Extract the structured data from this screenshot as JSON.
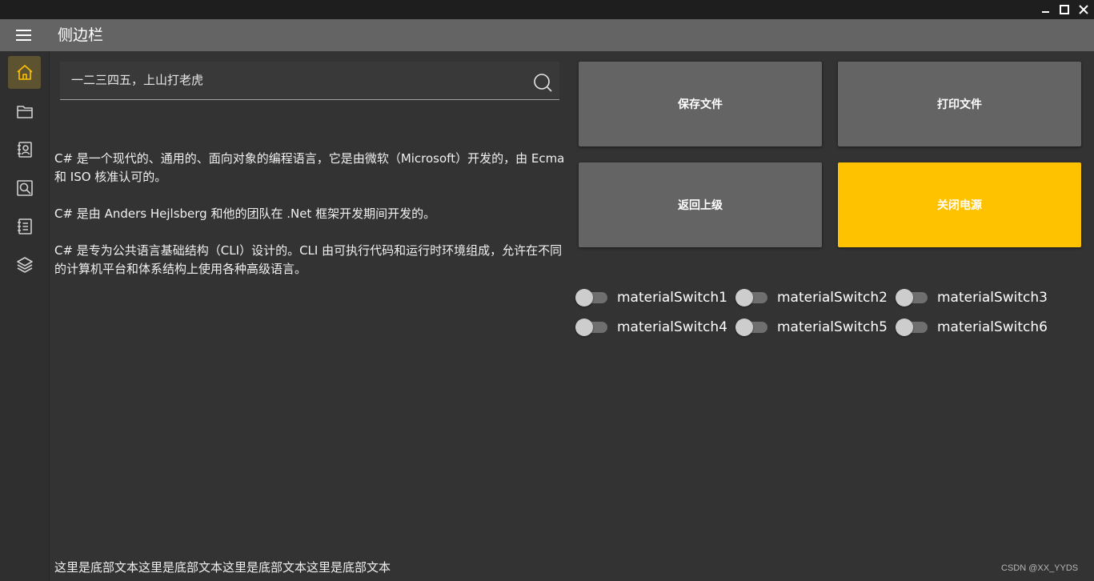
{
  "window": {
    "controls": [
      {
        "name": "minimize-button",
        "icon": "minimize-icon"
      },
      {
        "name": "maximize-button",
        "icon": "maximize-icon"
      },
      {
        "name": "close-window-button",
        "icon": "close-icon"
      }
    ]
  },
  "header": {
    "title": "侧边栏",
    "menu_icon": "hamburger-menu-icon",
    "background": "#646464"
  },
  "sidebar": {
    "items": [
      {
        "name": "home",
        "icon": "home-icon",
        "active": true
      },
      {
        "name": "folder",
        "icon": "folder-icon",
        "active": false
      },
      {
        "name": "contacts",
        "icon": "contact-book-icon",
        "active": false
      },
      {
        "name": "search",
        "icon": "search-icon",
        "active": false
      },
      {
        "name": "notes",
        "icon": "notebook-icon",
        "active": false
      },
      {
        "name": "layers",
        "icon": "layers-icon",
        "active": false
      }
    ],
    "active_color": "#ffc200"
  },
  "search": {
    "value": "一二三四五，上山打老虎",
    "icon": "search-icon"
  },
  "content": {
    "paragraphs": [
      "C# 是一个现代的、通用的、面向对象的编程语言，它是由微软（Microsoft）开发的，由 Ecma 和 ISO 核准认可的。",
      "C# 是由 Anders Hejlsberg 和他的团队在 .Net 框架开发期间开发的。",
      "C# 是专为公共语言基础结构（CLI）设计的。CLI 由可执行代码和运行时环境组成，允许在不同的计算机平台和体系结构上使用各种高级语言。"
    ]
  },
  "tiles": [
    {
      "label": "保存文件",
      "accent": false
    },
    {
      "label": "打印文件",
      "accent": false
    },
    {
      "label": "返回上级",
      "accent": false
    },
    {
      "label": "关闭电源",
      "accent": true
    }
  ],
  "tile_colors": {
    "normal": "#646464",
    "accent": "#ffc200"
  },
  "switches": [
    {
      "label": "materialSwitch1",
      "on": false
    },
    {
      "label": "materialSwitch2",
      "on": false
    },
    {
      "label": "materialSwitch3",
      "on": false
    },
    {
      "label": "materialSwitch4",
      "on": false
    },
    {
      "label": "materialSwitch5",
      "on": false
    },
    {
      "label": "materialSwitch6",
      "on": false
    }
  ],
  "footer": {
    "text": "这里是底部文本这里是底部文本这里是底部文本这里是底部文本",
    "watermark": "CSDN @XX_YYDS"
  }
}
